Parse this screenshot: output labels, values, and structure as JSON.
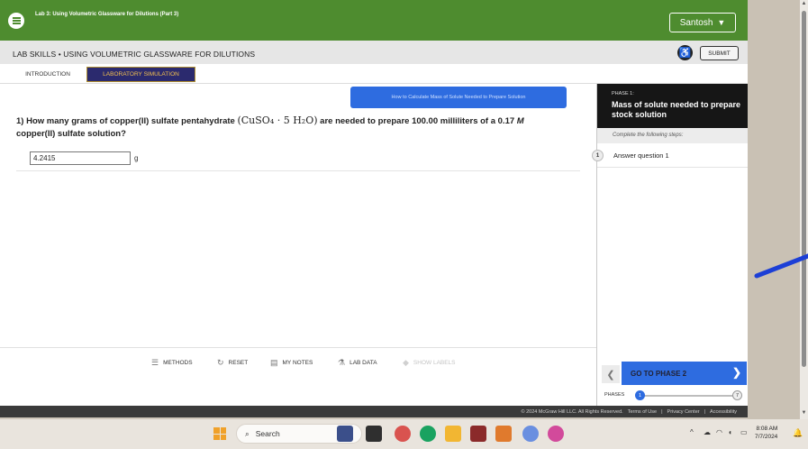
{
  "header": {
    "lab_title": "Lab 3: Using Volumetric Glassware for Dilutions (Part 3)",
    "user_name": "Santosh"
  },
  "subheader": {
    "title": "LAB SKILLS • USING VOLUMETRIC GLASSWARE FOR DILUTIONS",
    "submit_label": "SUBMIT"
  },
  "tabs": {
    "introduction": "INTRODUCTION",
    "simulation": "LABORATORY SIMULATION"
  },
  "main": {
    "help_button_label": "How to Calculate Mass of Solute Needed to Prepare Solution",
    "question_prefix": "1) How many grams of copper(II) sulfate pentahydrate",
    "question_formula": "(CuSO₄ · 5 H₂O)",
    "question_suffix": "are needed to prepare 100.00 milliliters of a 0.17",
    "question_molarity_unit": "M",
    "question_end": "copper(II) sulfate solution?",
    "answer_value": "4.2415",
    "answer_unit": "g"
  },
  "toolbar": {
    "methods": "METHODS",
    "reset": "RESET",
    "my_notes": "MY NOTES",
    "lab_data": "LAB DATA",
    "show_labels": "SHOW LABELS"
  },
  "sidepanel": {
    "phase_number": "PHASE 1:",
    "phase_title": "Mass of solute needed to prepare stock solution",
    "steps_label": "Complete the following steps:",
    "steps": [
      {
        "number": "1",
        "text": "Answer question 1"
      }
    ],
    "next_label": "GO TO PHASE 2",
    "phases_label": "PHASES",
    "phase_first": "1",
    "phase_last": "7"
  },
  "footer": {
    "copyright": "© 2024 McGraw Hill LLC. All Rights Reserved.",
    "terms": "Terms of Use",
    "privacy": "Privacy Center",
    "accessibility": "Accessibility"
  },
  "taskbar": {
    "search_label": "Search",
    "time": "8:08 AM",
    "date": "7/7/2024"
  },
  "colors": {
    "header_green": "#4e8c2f",
    "accent_blue": "#2e6ce0",
    "tab_navy": "#2b2a6e",
    "tab_gold": "#f3c04f"
  }
}
